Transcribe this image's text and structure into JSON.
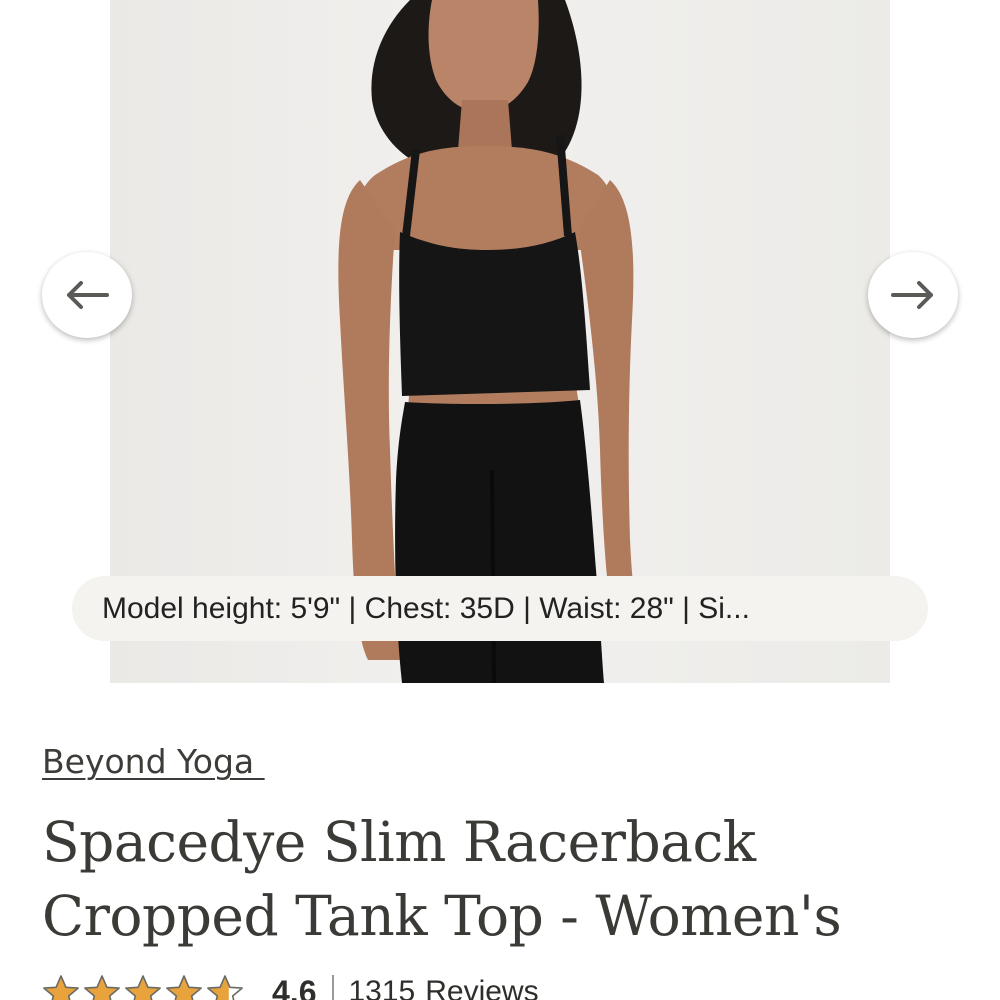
{
  "gallery": {
    "image_alt": "Model wearing black cropped racerback tank top and black leggings",
    "model_info": "Model height: 5'9\" | Chest: 35D | Waist: 28\" | Si..."
  },
  "product": {
    "brand": "Beyond Yoga ",
    "title_line1": "Spacedye Slim Racerback",
    "title_line2": "Cropped Tank Top - Women's"
  },
  "rating": {
    "value": "4.6",
    "stars": 4.6,
    "review_count": "1315",
    "review_label": "Reviews"
  },
  "colors": {
    "star": "#e8a33d",
    "text": "#2e2e2b",
    "pill_bg": "#f4f3ef"
  },
  "icons": {
    "prev": "arrow-left-icon",
    "next": "arrow-right-icon",
    "star": "star-icon"
  }
}
